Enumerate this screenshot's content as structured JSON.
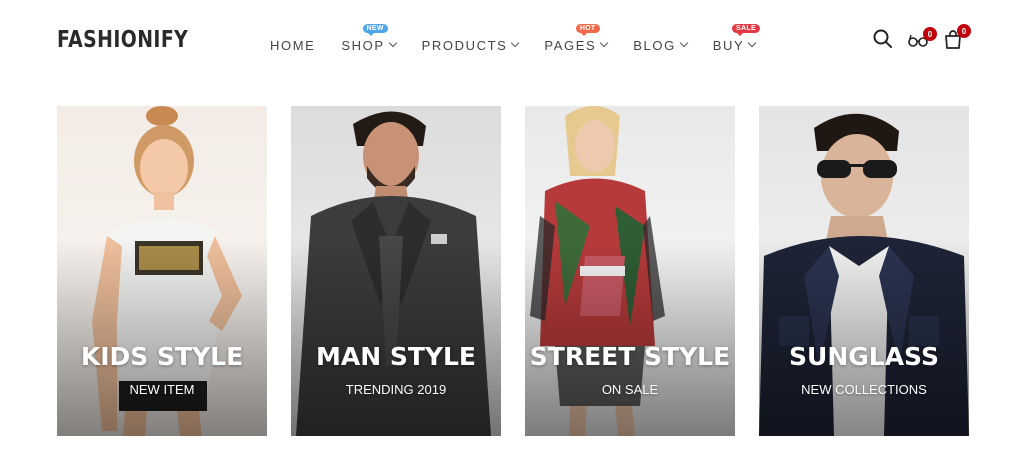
{
  "brand": {
    "logo_text": "FASHIONIFY"
  },
  "nav": [
    {
      "label": "HOME",
      "has_dropdown": false,
      "badge": null
    },
    {
      "label": "SHOP",
      "has_dropdown": true,
      "badge": "NEW"
    },
    {
      "label": "PRODUCTS",
      "has_dropdown": true,
      "badge": null
    },
    {
      "label": "PAGES",
      "has_dropdown": true,
      "badge": "HOT"
    },
    {
      "label": "BLOG",
      "has_dropdown": true,
      "badge": null
    },
    {
      "label": "BUY",
      "has_dropdown": true,
      "badge": "SALE"
    }
  ],
  "header_icons": {
    "search": {
      "icon": "search-icon"
    },
    "wishlist": {
      "icon": "glasses-icon",
      "count": "0"
    },
    "cart": {
      "icon": "shopping-bag-icon",
      "count": "0"
    }
  },
  "colors": {
    "badge_new": "#4da6ea",
    "badge_hot": "#f06a4a",
    "badge_sale": "#e53945",
    "count_badge": "#c0000c",
    "logo": "#2b2b2b"
  },
  "categories": [
    {
      "title": "KIDS STYLE",
      "subtitle": "NEW ITEM"
    },
    {
      "title": "MAN STYLE",
      "subtitle": "TRENDING 2019"
    },
    {
      "title": "STREET STYLE",
      "subtitle": "ON SALE"
    },
    {
      "title": "SUNGLASS",
      "subtitle": "NEW COLLECTIONS"
    }
  ]
}
